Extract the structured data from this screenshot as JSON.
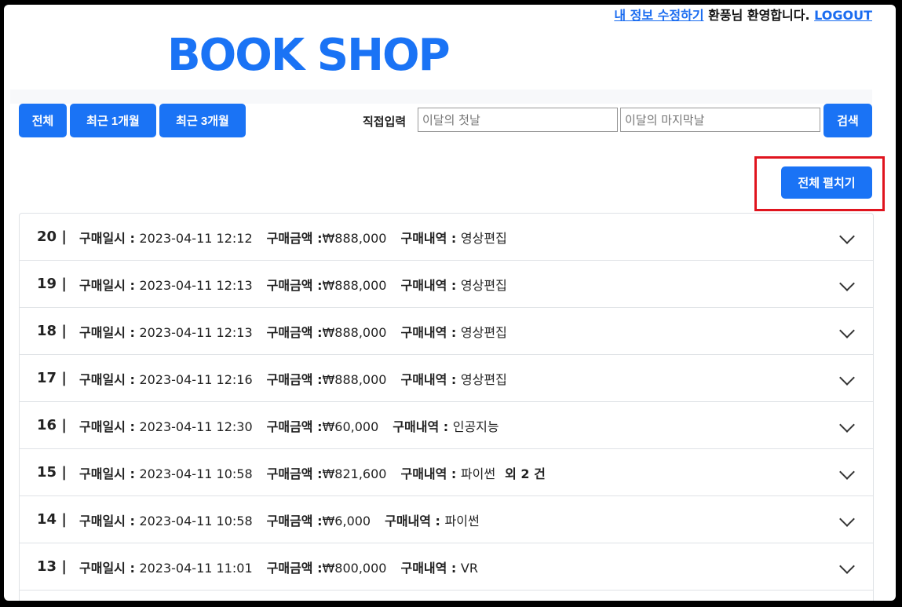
{
  "header": {
    "edit_profile_link": "내 정보 수정하기",
    "welcome_text": "환풍님 환영합니다.",
    "logout_link": "LOGOUT",
    "logo": "BOOK SHOP"
  },
  "filters": {
    "all_label": "전체",
    "one_month_label": "최근 1개월",
    "three_month_label": "최근 3개월",
    "direct_input_label": "직접입력",
    "start_placeholder": "이달의 첫날",
    "end_placeholder": "이달의 마지막날",
    "search_label": "검색"
  },
  "expand_all_label": "전체 펼치기",
  "labels": {
    "date": "구매일시 :",
    "amount": "구매금액 :",
    "items": "구매내역 :"
  },
  "orders": [
    {
      "num": "20 |",
      "date": "2023-04-11 12:12",
      "amount": "₩888,000",
      "items": "영상편집",
      "extra": ""
    },
    {
      "num": "19 |",
      "date": "2023-04-11 12:13",
      "amount": "₩888,000",
      "items": "영상편집",
      "extra": ""
    },
    {
      "num": "18 |",
      "date": "2023-04-11 12:13",
      "amount": "₩888,000",
      "items": "영상편집",
      "extra": ""
    },
    {
      "num": "17 |",
      "date": "2023-04-11 12:16",
      "amount": "₩888,000",
      "items": "영상편집",
      "extra": ""
    },
    {
      "num": "16 |",
      "date": "2023-04-11 12:30",
      "amount": "₩60,000",
      "items": "인공지능",
      "extra": ""
    },
    {
      "num": "15 |",
      "date": "2023-04-11 10:58",
      "amount": "₩821,600",
      "items": "파이썬",
      "extra": "외 2 건"
    },
    {
      "num": "14 |",
      "date": "2023-04-11 10:58",
      "amount": "₩6,000",
      "items": "파이썬",
      "extra": ""
    },
    {
      "num": "13 |",
      "date": "2023-04-11 11:01",
      "amount": "₩800,000",
      "items": "VR",
      "extra": ""
    }
  ]
}
